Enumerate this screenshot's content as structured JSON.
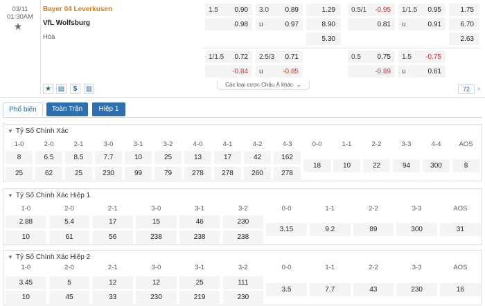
{
  "match": {
    "date": "03/11",
    "time": "01:30AM",
    "home": "Bayer 04 Leverkusen",
    "away": "VfL Wolfsburg",
    "draw": "Hòa",
    "ft_hdp": {
      "line": "1.5",
      "home": "0.90",
      "away": "0.98"
    },
    "ft_ou": {
      "line": "3.0",
      "over": "0.89",
      "u": "u",
      "under": "0.97"
    },
    "ft_1x2": {
      "home": "1.29",
      "away": "8.90",
      "draw": "5.30"
    },
    "h1_hdp": {
      "line": "0.5/1",
      "home": "-0.95",
      "away": "0.81"
    },
    "h1_ou": {
      "line": "1/1.5",
      "over": "0.95",
      "u": "u",
      "under": "0.91"
    },
    "h1_1x2": {
      "home": "1.75",
      "away": "6.70",
      "draw": "2.63"
    },
    "ft_hdp2": {
      "line": "1/1.5",
      "home": "0.72",
      "away": "-0.84"
    },
    "ft_ou2": {
      "line": "2.5/3",
      "over": "0.71",
      "u": "u",
      "under": "-0.85"
    },
    "h1_hdp2": {
      "line": "0.5",
      "home": "0.75",
      "away": "-0.89"
    },
    "h1_ou2": {
      "line": "1.5",
      "over": "-0.75",
      "u": "u",
      "under": "0.61"
    },
    "more_bets": "Các loại cược Châu Á khác",
    "bet_count": "72"
  },
  "icons": {
    "star": "★",
    "stats": "▤",
    "dollar": "$",
    "chart": "▥",
    "chevron_down": "⌄",
    "chevron_right": ">",
    "section_chevron": "▼"
  },
  "tabs": [
    "Phổ biến",
    "Toàn Trận",
    "Hiệp 1"
  ],
  "sections": [
    {
      "title": "Tỷ Số Chính Xác",
      "headers": [
        "1-0",
        "2-0",
        "2-1",
        "3-0",
        "3-1",
        "3-2",
        "4-0",
        "4-1",
        "4-2",
        "4-3",
        "0-0",
        "1-1",
        "2-2",
        "3-3",
        "4-4",
        "AOS"
      ],
      "home": [
        "8",
        "6.5",
        "8.5",
        "7.7",
        "10",
        "25",
        "13",
        "17",
        "42",
        "162"
      ],
      "away": [
        "25",
        "62",
        "25",
        "230",
        "99",
        "79",
        "278",
        "278",
        "260",
        "278"
      ],
      "draws": [
        "18",
        "10",
        "22",
        "94",
        "300",
        "8"
      ]
    },
    {
      "title": "Tỷ Số Chính Xác Hiệp 1",
      "headers": [
        "1-0",
        "2-0",
        "2-1",
        "3-0",
        "3-1",
        "3-2",
        "0-0",
        "1-1",
        "2-2",
        "3-3",
        "AOS"
      ],
      "home": [
        "2.88",
        "5.4",
        "17",
        "15",
        "46",
        "230"
      ],
      "away": [
        "10",
        "61",
        "56",
        "238",
        "238",
        "238"
      ],
      "draws": [
        "3.15",
        "9.2",
        "89",
        "300",
        "31"
      ]
    },
    {
      "title": "Tỷ Số Chính Xác Hiệp 2",
      "headers": [
        "1-0",
        "2-0",
        "2-1",
        "3-0",
        "3-1",
        "3-2",
        "0-0",
        "1-1",
        "2-2",
        "3-3",
        "AOS"
      ],
      "home": [
        "3.45",
        "5",
        "12",
        "12",
        "25",
        "111"
      ],
      "away": [
        "10",
        "45",
        "33",
        "230",
        "219",
        "230"
      ],
      "draws": [
        "3.5",
        "7.7",
        "43",
        "230",
        "16"
      ]
    }
  ],
  "colors": {
    "team_home": "#e07b10",
    "negative": "#d62d2d",
    "tab_active_text": "#1f63a8",
    "tab_inactive_bg": "#2e6fb0",
    "cell_bg": "#f4f4f4"
  }
}
